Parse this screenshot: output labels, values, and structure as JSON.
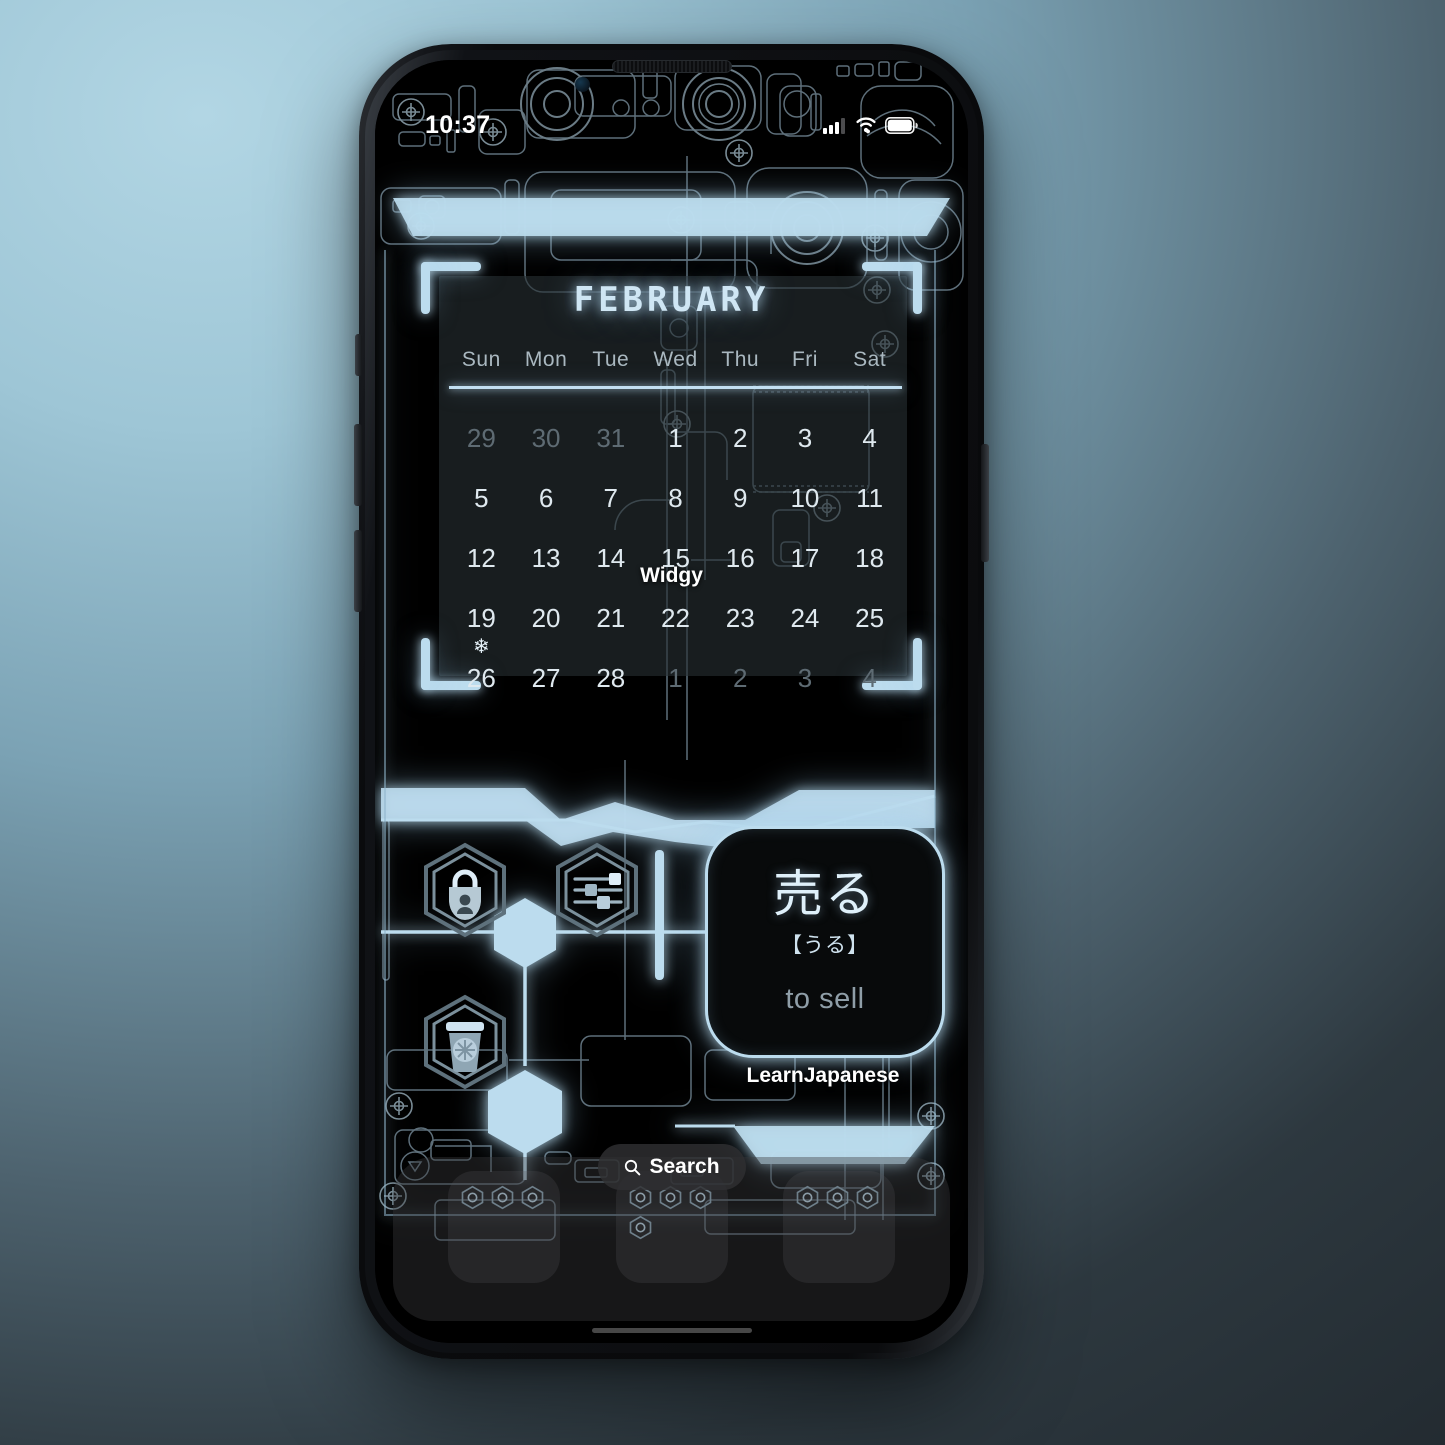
{
  "device": {
    "type": "smartphone",
    "orientation": "portrait"
  },
  "status_bar": {
    "time": "10:37",
    "icons": [
      "cellular-signal-icon",
      "wifi-icon",
      "battery-icon"
    ]
  },
  "calendar_widget": {
    "month": "FEBRUARY",
    "widget_label": "Widgy",
    "day_headers": [
      "Sun",
      "Mon",
      "Tue",
      "Wed",
      "Thu",
      "Fri",
      "Sat"
    ],
    "weeks": [
      [
        {
          "n": "29",
          "dim": true
        },
        {
          "n": "30",
          "dim": true
        },
        {
          "n": "31",
          "dim": true
        },
        {
          "n": "1",
          "dim": false
        },
        {
          "n": "2",
          "dim": false
        },
        {
          "n": "3",
          "dim": false
        },
        {
          "n": "4",
          "dim": false
        }
      ],
      [
        {
          "n": "5",
          "dim": false
        },
        {
          "n": "6",
          "dim": false
        },
        {
          "n": "7",
          "dim": false
        },
        {
          "n": "8",
          "dim": false
        },
        {
          "n": "9",
          "dim": false
        },
        {
          "n": "10",
          "dim": false
        },
        {
          "n": "11",
          "dim": false
        }
      ],
      [
        {
          "n": "12",
          "dim": false
        },
        {
          "n": "13",
          "dim": false
        },
        {
          "n": "14",
          "dim": false
        },
        {
          "n": "15",
          "dim": false
        },
        {
          "n": "16",
          "dim": false
        },
        {
          "n": "17",
          "dim": false
        },
        {
          "n": "18",
          "dim": false
        }
      ],
      [
        {
          "n": "19",
          "dim": false
        },
        {
          "n": "20",
          "dim": false
        },
        {
          "n": "21",
          "dim": false
        },
        {
          "n": "22",
          "dim": false
        },
        {
          "n": "23",
          "dim": false
        },
        {
          "n": "24",
          "dim": false
        },
        {
          "n": "25",
          "dim": false
        }
      ],
      [
        {
          "n": "26",
          "dim": false,
          "marker": "❄"
        },
        {
          "n": "27",
          "dim": false
        },
        {
          "n": "28",
          "dim": false
        },
        {
          "n": "1",
          "dim": true
        },
        {
          "n": "2",
          "dim": true
        },
        {
          "n": "3",
          "dim": true
        },
        {
          "n": "4",
          "dim": true
        }
      ]
    ]
  },
  "app_icons": [
    {
      "name": "password-manager",
      "icon": "lock-shield-person-icon"
    },
    {
      "name": "settings",
      "icon": "sliders-icon"
    },
    {
      "name": "coffee",
      "icon": "coffee-cup-icon"
    }
  ],
  "japanese_widget": {
    "word": "売る",
    "reading": "【うる】",
    "meaning": "to sell",
    "widget_label": "LearnJapanese"
  },
  "search": {
    "label": "Search",
    "icon": "magnifier-icon"
  },
  "dock": {
    "folders": [
      {
        "name": "folder-one",
        "mini_icons": [
          "hex-app-icon",
          "hex-app-icon",
          "hex-leaf-icon"
        ]
      },
      {
        "name": "folder-two",
        "mini_icons": [
          "hex-app-icon",
          "hex-clock-icon",
          "hex-person-icon",
          "hex-dot-icon"
        ]
      },
      {
        "name": "folder-three",
        "mini_icons": [
          "hex-chat-icon",
          "hex-book-icon",
          "hex-diamond-icon"
        ]
      }
    ]
  },
  "theme": {
    "accent": "#bcdcee",
    "glow": "#a9d2ea",
    "panel": "#262e32",
    "background_top": "#b2d6e4",
    "background_bottom": "#222a30",
    "screen_bg": "#000000"
  }
}
